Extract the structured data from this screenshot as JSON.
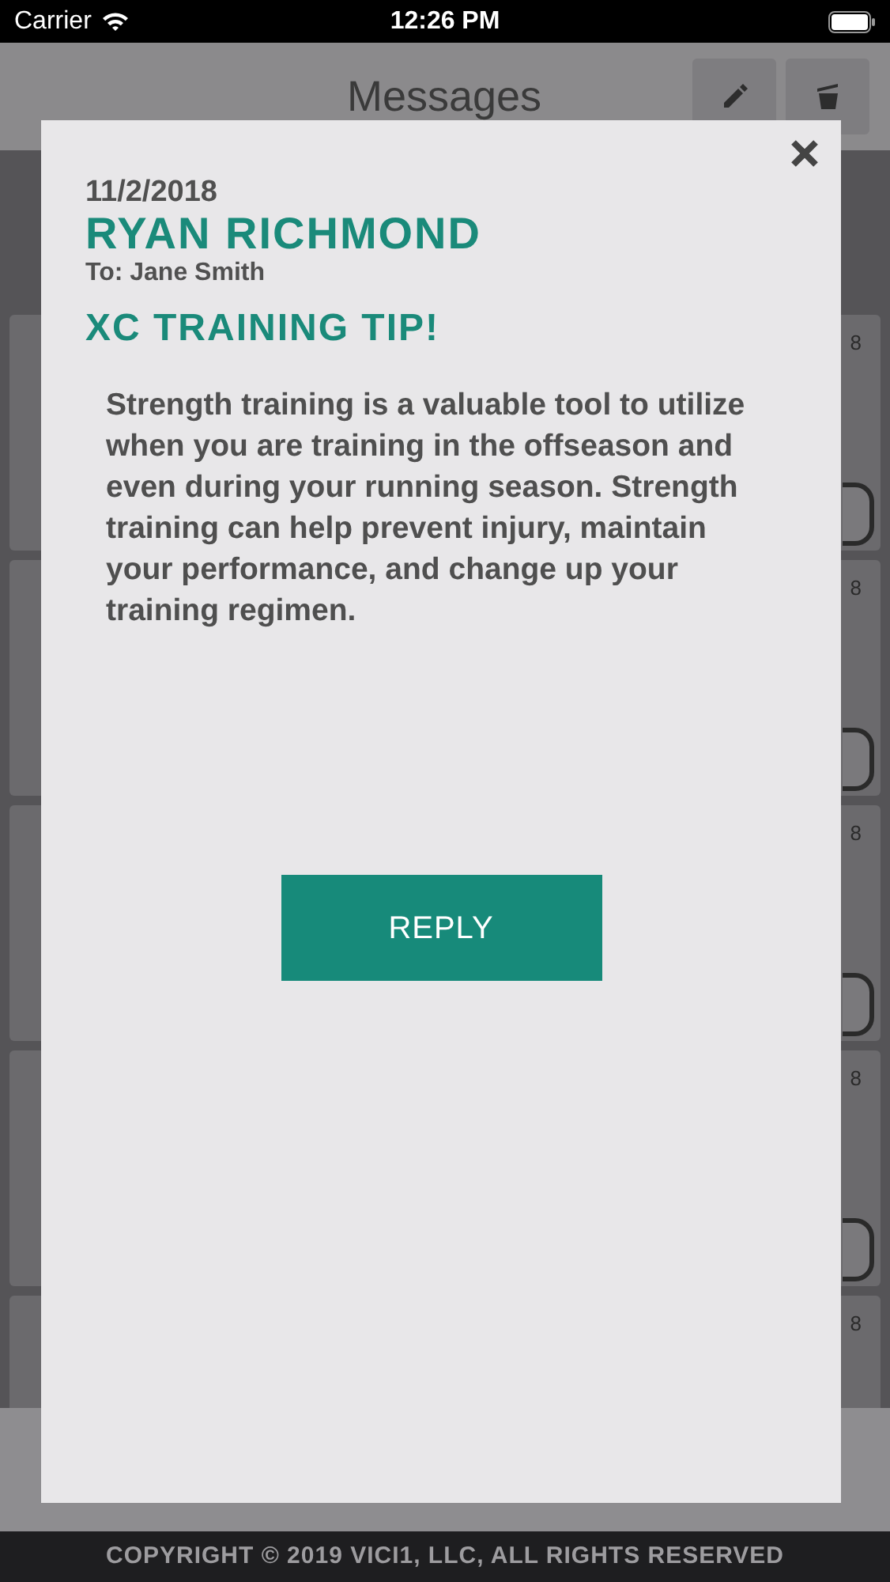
{
  "status_bar": {
    "carrier": "Carrier",
    "time": "12:26 PM"
  },
  "header": {
    "title": "Messages"
  },
  "list": {
    "cards": [
      {
        "date_fragment": "8",
        "has_button": true
      },
      {
        "date_fragment": "8",
        "has_button": true
      },
      {
        "date_fragment": "8",
        "has_button": true
      },
      {
        "date_fragment": "8",
        "has_button": true
      },
      {
        "date_fragment": "8"
      }
    ]
  },
  "modal": {
    "date": "11/2/2018",
    "sender": "RYAN RICHMOND",
    "recipient": "To: Jane Smith",
    "subject": "XC TRAINING TIP!",
    "body": "Strength training is a valuable tool to utilize when you are training in the offseason and even during your running season. Strength training can help prevent injury, maintain your performance, and change up your training regimen.",
    "reply_button": "REPLY"
  },
  "footer": {
    "copyright": "COPYRIGHT © 2019 VICI1, LLC, ALL RIGHTS RESERVED"
  }
}
